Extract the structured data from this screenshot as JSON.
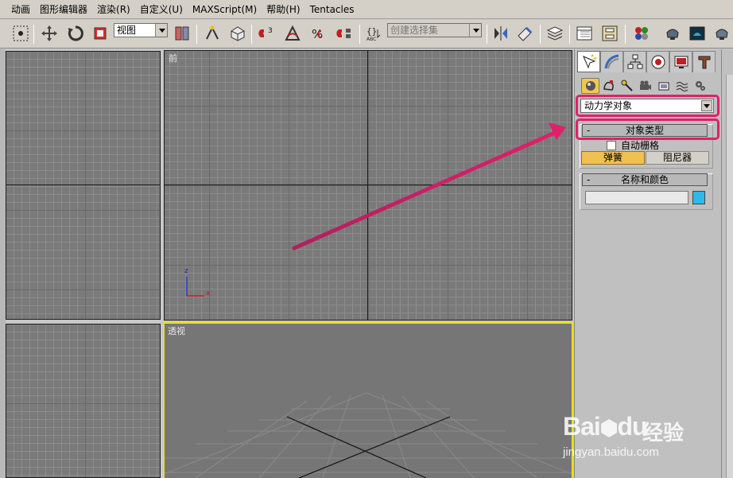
{
  "menu": {
    "items": [
      "动画",
      "图形编辑器",
      "渲染(R)",
      "自定义(U)",
      "MAXScript(M)",
      "帮助(H)",
      "Tentacles"
    ]
  },
  "toolbar": {
    "view_combo": "视图",
    "selection_set_placeholder": "创建选择集",
    "icons": [
      "select-icon",
      "move-icon",
      "rotate-icon",
      "scale-icon",
      "view-dropdown",
      "pivot-icon",
      "manipulate-icon",
      "keyboard-shortcut-icon",
      "snap-icon",
      "angle-snap-icon",
      "percent-snap-icon",
      "spinner-snap-icon",
      "edit-named-selection-icon",
      "mirror-icon",
      "align-icon",
      "layer-manager-icon",
      "curve-editor-icon",
      "schematic-view-icon",
      "material-editor-icon",
      "render-setup-icon",
      "rendered-frame-icon",
      "quick-render-icon"
    ]
  },
  "viewports": {
    "front_label": "前",
    "perspective_label": "透视",
    "axis_z": "z",
    "axis_x": "x"
  },
  "command_panel": {
    "tabs": [
      "create-tab",
      "modify-tab",
      "hierarchy-tab",
      "motion-tab",
      "display-tab",
      "utilities-tab"
    ],
    "subtabs": [
      "geometry-icon",
      "shapes-icon",
      "lights-icon",
      "cameras-icon",
      "helpers-icon",
      "space-warps-icon",
      "systems-icon"
    ],
    "category_dropdown": "动力学对象",
    "object_type_title": "对象类型",
    "auto_grid_label": "自动栅格",
    "buttons": [
      "弹簧",
      "阻尼器"
    ],
    "name_color_title": "名称和颜色",
    "name_value": "",
    "rollout_minus": "-",
    "object_color": "#30b8e8"
  },
  "annotation": {
    "highlight_color": "#e0206a"
  },
  "watermark": {
    "brand": "Bai",
    "brand2": "du",
    "cn": "经验",
    "url": "jingyan.baidu.com"
  }
}
